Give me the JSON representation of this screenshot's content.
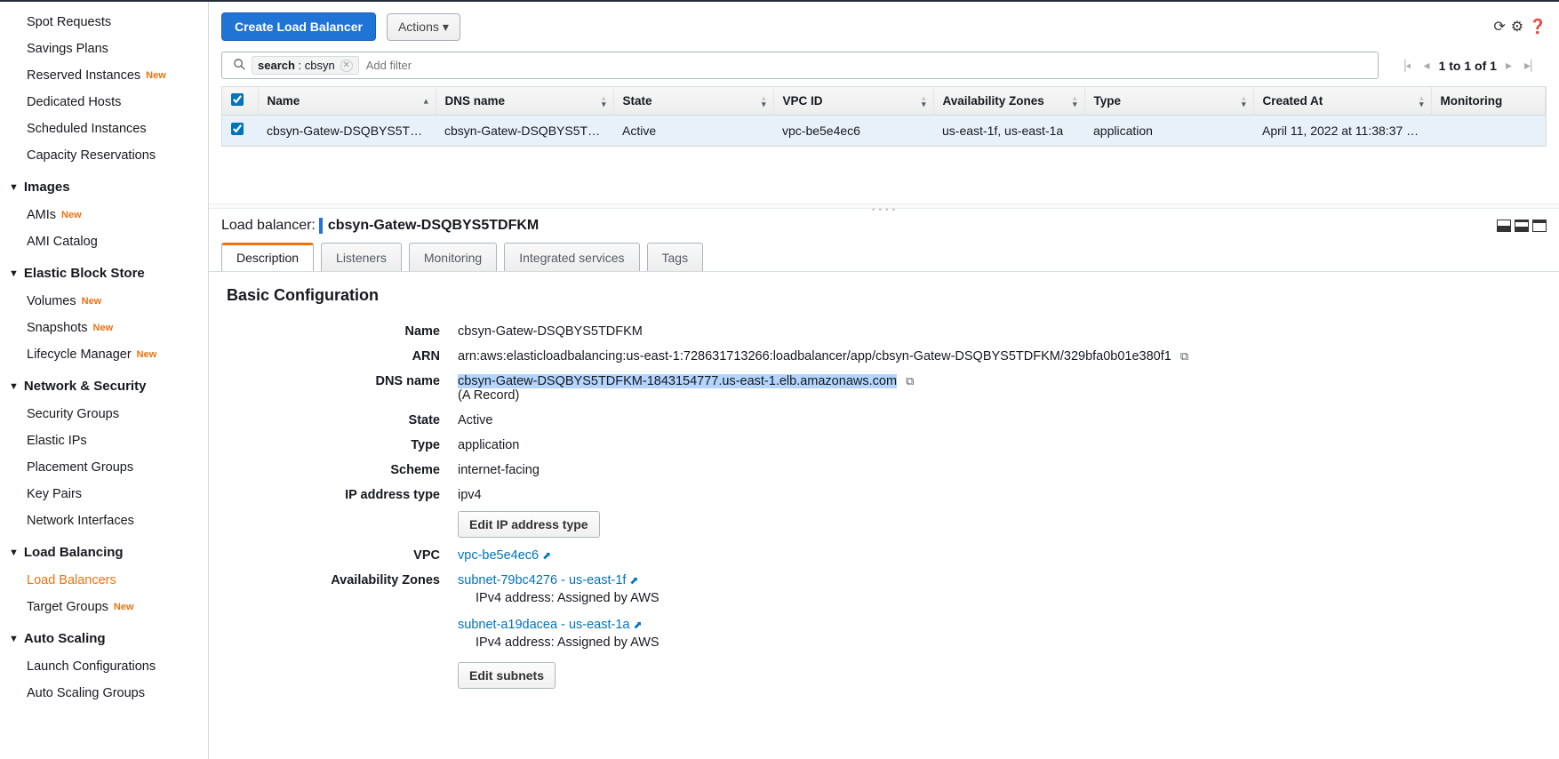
{
  "sidebar": {
    "topItems": [
      {
        "label": "Spot Requests"
      },
      {
        "label": "Savings Plans"
      },
      {
        "label": "Reserved Instances",
        "new": true
      },
      {
        "label": "Dedicated Hosts"
      },
      {
        "label": "Scheduled Instances"
      },
      {
        "label": "Capacity Reservations"
      }
    ],
    "sections": [
      {
        "title": "Images",
        "items": [
          {
            "label": "AMIs",
            "new": true
          },
          {
            "label": "AMI Catalog"
          }
        ]
      },
      {
        "title": "Elastic Block Store",
        "items": [
          {
            "label": "Volumes",
            "new": true
          },
          {
            "label": "Snapshots",
            "new": true
          },
          {
            "label": "Lifecycle Manager",
            "new": true
          }
        ]
      },
      {
        "title": "Network & Security",
        "items": [
          {
            "label": "Security Groups"
          },
          {
            "label": "Elastic IPs"
          },
          {
            "label": "Placement Groups"
          },
          {
            "label": "Key Pairs"
          },
          {
            "label": "Network Interfaces"
          }
        ]
      },
      {
        "title": "Load Balancing",
        "items": [
          {
            "label": "Load Balancers",
            "active": true
          },
          {
            "label": "Target Groups",
            "new": true
          }
        ]
      },
      {
        "title": "Auto Scaling",
        "items": [
          {
            "label": "Launch Configurations"
          },
          {
            "label": "Auto Scaling Groups"
          }
        ]
      }
    ],
    "newBadge": "New"
  },
  "toolbar": {
    "create": "Create Load Balancer",
    "actions": "Actions"
  },
  "filter": {
    "chipKey": "search",
    "chipVal": "cbsyn",
    "placeholder": "Add filter"
  },
  "pager": {
    "label": "1 to 1 of 1"
  },
  "table": {
    "cols": [
      "Name",
      "DNS name",
      "State",
      "VPC ID",
      "Availability Zones",
      "Type",
      "Created At",
      "Monitoring"
    ],
    "row": {
      "name": "cbsyn-Gatew-DSQBYS5TDF…",
      "dns": "cbsyn-Gatew-DSQBYS5TDF…",
      "state": "Active",
      "vpc": "vpc-be5e4ec6",
      "az": "us-east-1f, us-east-1a",
      "type": "application",
      "created": "April 11, 2022 at 11:38:37 P…"
    }
  },
  "detail": {
    "headerLabel": "Load balancer:",
    "name": "cbsyn-Gatew-DSQBYS5TDFKM",
    "tabs": [
      "Description",
      "Listeners",
      "Monitoring",
      "Integrated services",
      "Tags"
    ],
    "sectionTitle": "Basic Configuration",
    "fields": {
      "nameKey": "Name",
      "nameVal": "cbsyn-Gatew-DSQBYS5TDFKM",
      "arnKey": "ARN",
      "arnVal": "arn:aws:elasticloadbalancing:us-east-1:728631713266:loadbalancer/app/cbsyn-Gatew-DSQBYS5TDFKM/329bfa0b01e380f1",
      "dnsKey": "DNS name",
      "dnsVal": "cbsyn-Gatew-DSQBYS5TDFKM-1843154777.us-east-1.elb.amazonaws.com",
      "dnsSub": "(A Record)",
      "stateKey": "State",
      "stateVal": "Active",
      "typeKey": "Type",
      "typeVal": "application",
      "schemeKey": "Scheme",
      "schemeVal": "internet-facing",
      "ipKey": "IP address type",
      "ipVal": "ipv4",
      "editIpBtn": "Edit IP address type",
      "vpcKey": "VPC",
      "vpcVal": "vpc-be5e4ec6",
      "azKey": "Availability Zones",
      "az1Link": "subnet-79bc4276 - us-east-1f",
      "az1Sub": "IPv4 address: Assigned by AWS",
      "az2Link": "subnet-a19dacea - us-east-1a",
      "az2Sub": "IPv4 address: Assigned by AWS",
      "editSubnetsBtn": "Edit subnets"
    }
  }
}
